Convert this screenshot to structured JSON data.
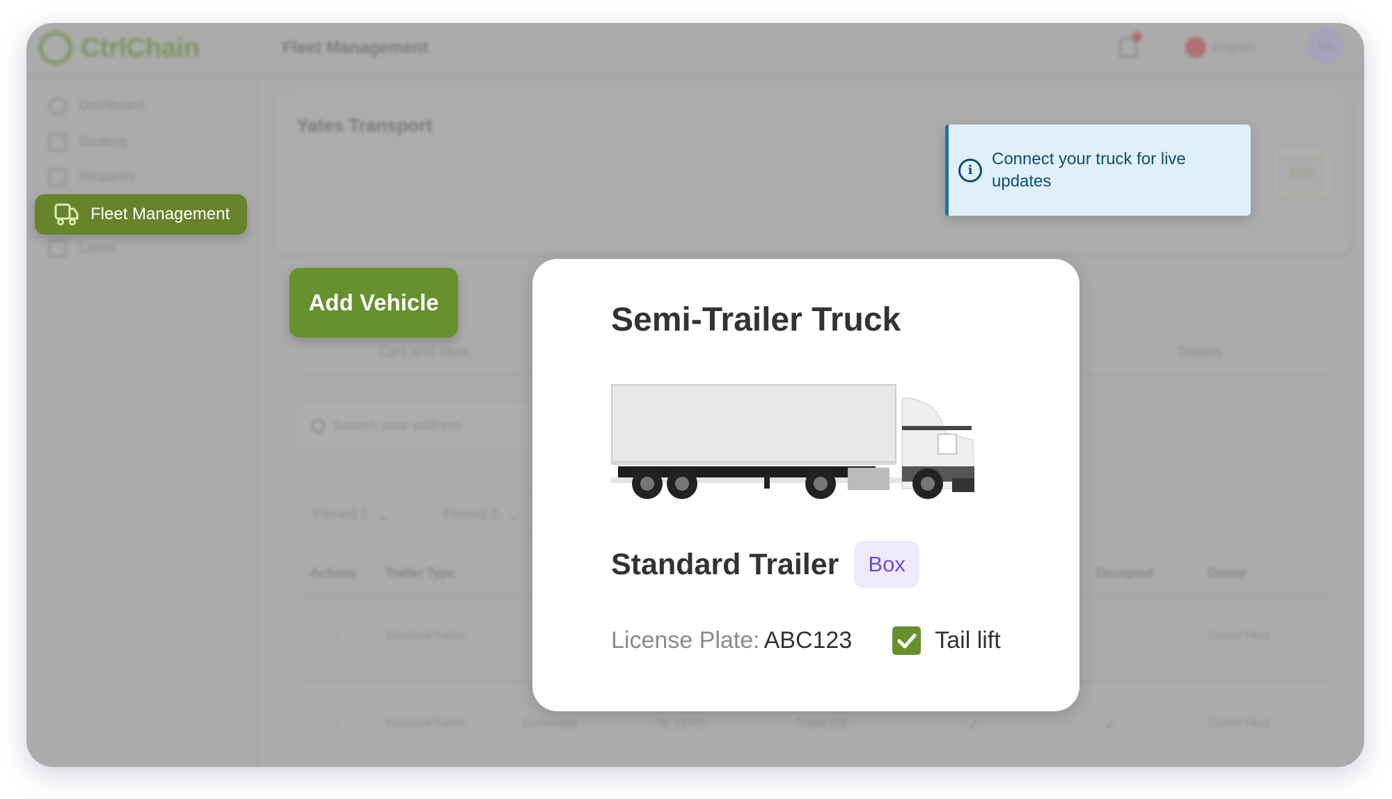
{
  "app": {
    "logo": "CtrlChain",
    "header_title": "Fleet Management",
    "language": "English",
    "avatar_initials": "DS"
  },
  "sidebar": {
    "items": [
      {
        "label": "Dashboard"
      },
      {
        "label": "Booking"
      },
      {
        "label": "Requests"
      },
      {
        "label": "Fleet Management",
        "active": true
      },
      {
        "label": "Lanes"
      }
    ]
  },
  "company": {
    "name": "Yates Transport",
    "edit_label": "Edit"
  },
  "alert": {
    "text": "Connect your truck for live updates",
    "icon": "info-icon"
  },
  "add_vehicle_label": "Add Vehicle",
  "tabs": [
    {
      "label": "Cars and Vans"
    },
    {
      "label": "Trailers"
    }
  ],
  "search": {
    "placeholder": "Search your address"
  },
  "filters": [
    {
      "label": "Pinned 1"
    },
    {
      "label": "Pinned 2"
    }
  ],
  "table": {
    "headers": {
      "actions": "Actions",
      "trailer_type": "Trailer Type",
      "occupied": "Occupied",
      "owner": "Owner"
    },
    "rows": [
      {
        "trailer_type": "Standard Trailer",
        "occupied": "-",
        "owner": "Owner Fleet"
      },
      {
        "trailer_type": "Standard Trailer",
        "body": "Curtainside",
        "plate": "NL 12345",
        "name": "Trailer123",
        "col5": "✓",
        "occupied": "✓",
        "owner": "Owner Fleet"
      }
    ]
  },
  "modal": {
    "title": "Semi-Trailer Truck",
    "trailer_type": "Standard Trailer",
    "body_badge": "Box",
    "plate_label": "License Plate",
    "plate_sep": ":",
    "plate_value": "ABC123",
    "tail_lift_label": "Tail lift",
    "tail_lift_checked": true
  },
  "colors": {
    "brand_green": "#67832b",
    "badge_purple": "#6b4fc8",
    "alert_blue": "#1f73a8"
  }
}
